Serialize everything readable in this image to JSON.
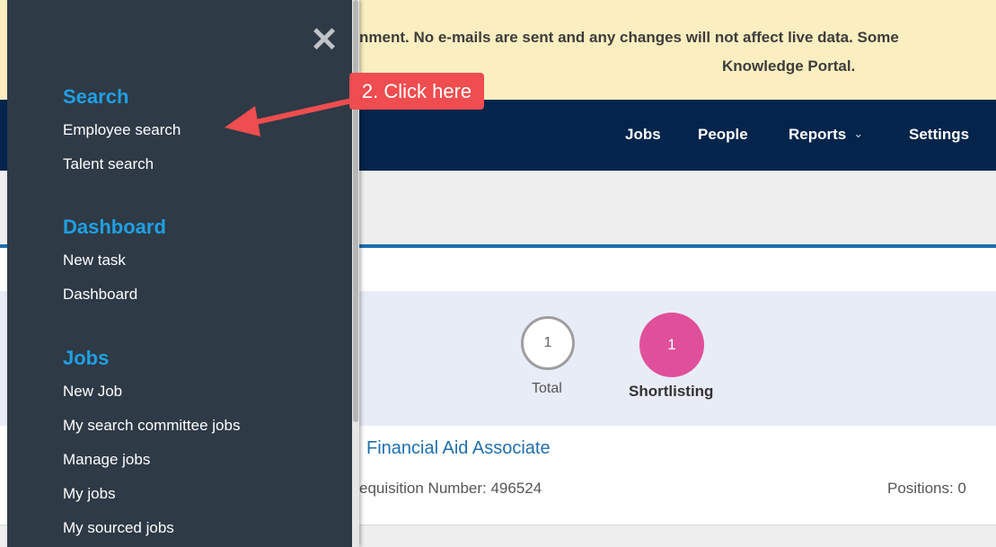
{
  "banner": {
    "line1": "nment. No e-mails are sent and any changes will not affect live data. Some",
    "line2": "Knowledge Portal."
  },
  "topnav": {
    "items": [
      {
        "label": "Jobs"
      },
      {
        "label": "People"
      },
      {
        "label": "Reports"
      },
      {
        "label": "Settings"
      }
    ],
    "reports_chevron": "⌄"
  },
  "stats": {
    "total": {
      "count": "1",
      "label": "Total"
    },
    "shortlisting": {
      "count": "1",
      "label": "Shortlisting",
      "color": "#e0509a"
    }
  },
  "job": {
    "title": "Financial Aid Associate",
    "requisition": "equisition Number: 496524",
    "positions": "Positions: 0"
  },
  "drawer": {
    "close_glyph": "✕",
    "sections": [
      {
        "heading": "Search",
        "items": [
          "Employee search",
          "Talent search"
        ]
      },
      {
        "heading": "Dashboard",
        "items": [
          "New task",
          "Dashboard"
        ]
      },
      {
        "heading": "Jobs",
        "items": [
          "New Job",
          "My search committee jobs",
          "Manage jobs",
          "My jobs",
          "My sourced jobs"
        ]
      }
    ],
    "background": "#2e3a46",
    "heading_color": "#1fa0e3"
  },
  "annotation": {
    "callout": "2. Click here",
    "color": "#ef4d4f"
  }
}
